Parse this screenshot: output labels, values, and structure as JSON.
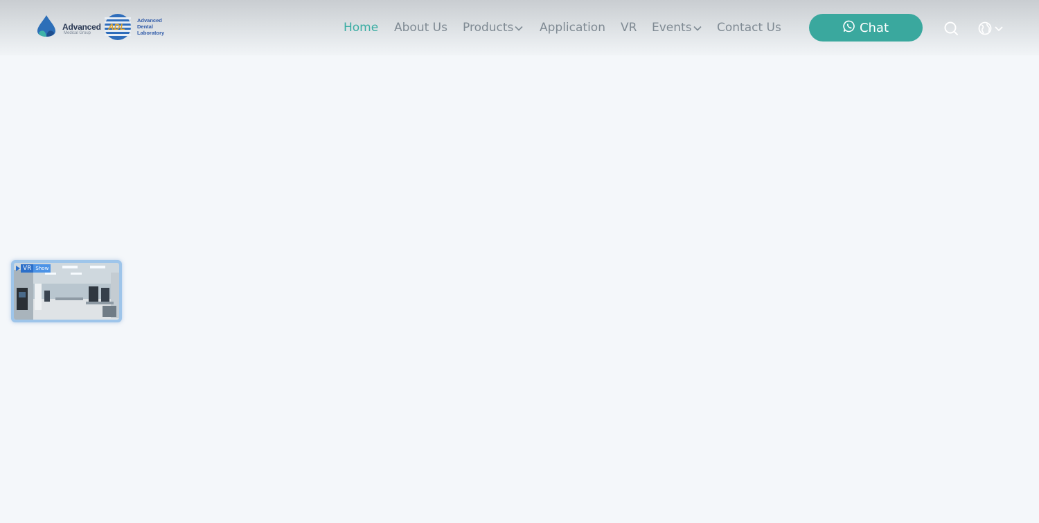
{
  "header": {
    "logo": {
      "amg_name": "Advanced",
      "amg_sub": "Medical Group",
      "adl_lines": [
        "Advanced",
        "Dental",
        "Laboratory"
      ]
    },
    "nav": [
      {
        "label": "Home",
        "active": true,
        "dropdown": false
      },
      {
        "label": "About Us",
        "active": false,
        "dropdown": false
      },
      {
        "label": "Products",
        "active": false,
        "dropdown": true
      },
      {
        "label": "Application",
        "active": false,
        "dropdown": false
      },
      {
        "label": "VR",
        "active": false,
        "dropdown": false
      },
      {
        "label": "Events",
        "active": false,
        "dropdown": true
      },
      {
        "label": "Contact Us",
        "active": false,
        "dropdown": false
      }
    ],
    "chat_label": "Chat",
    "icons": {
      "chat": "whatsapp-icon",
      "search": "search-icon",
      "language": "globe-icon",
      "dropdown": "chevron-down-icon"
    }
  },
  "vr_widget": {
    "badge_vr": "VR",
    "badge_show": "Show"
  },
  "colors": {
    "accent": "#3aa89e",
    "nav_text": "#7f8a93",
    "nav_active": "#3aada3",
    "page_bg": "#f4f7fa"
  }
}
